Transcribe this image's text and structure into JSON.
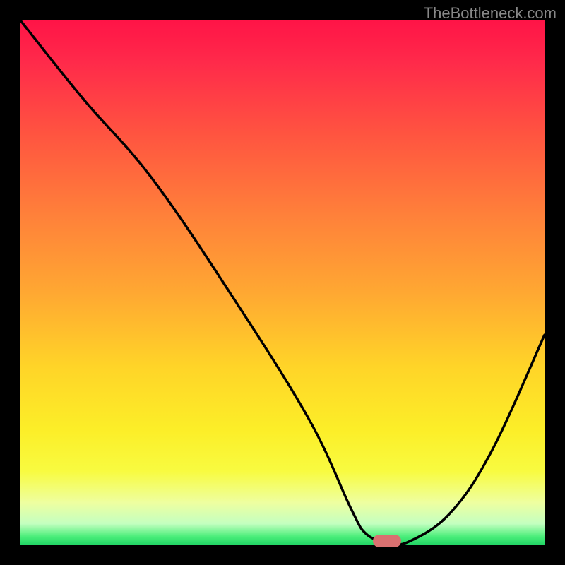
{
  "watermark": "TheBottleneck.com",
  "chart_data": {
    "type": "line",
    "title": "",
    "xlabel": "",
    "ylabel": "",
    "xlim": [
      0,
      100
    ],
    "ylim": [
      0,
      100
    ],
    "x": [
      0,
      12,
      25,
      40,
      55,
      63,
      66,
      70,
      74,
      82,
      90,
      100
    ],
    "values": [
      100,
      85,
      70,
      48,
      24,
      7,
      2,
      0.5,
      0.5,
      6,
      18,
      40
    ],
    "marker": {
      "x": 70,
      "y": 0.7
    },
    "grid": false,
    "legend_position": "none",
    "colors": {
      "line": "#000000",
      "marker": "#d97070"
    }
  }
}
